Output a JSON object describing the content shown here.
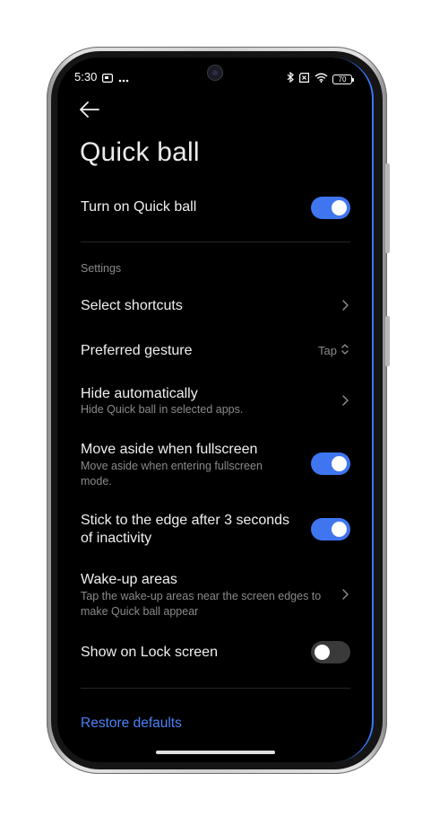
{
  "status_bar": {
    "time": "5:30",
    "left_icons": [
      "gallery-icon",
      "more-icon"
    ],
    "right_icons": [
      "bluetooth-icon",
      "no-sim-icon",
      "wifi-icon",
      "battery-icon"
    ],
    "battery": "70"
  },
  "header": {
    "back_icon": "back-arrow-icon",
    "title": "Quick ball"
  },
  "main_toggle": {
    "label": "Turn on Quick ball",
    "enabled": true
  },
  "settings": {
    "section_label": "Settings",
    "select_shortcuts": {
      "label": "Select shortcuts"
    },
    "preferred_gesture": {
      "label": "Preferred gesture",
      "value": "Tap"
    },
    "hide_automatically": {
      "label": "Hide automatically",
      "description": "Hide Quick ball in selected apps."
    },
    "move_aside": {
      "label": "Move aside when fullscreen",
      "description_line1": "Move aside when entering fullscreen",
      "description_line2": "mode.",
      "enabled": true
    },
    "stick_to_edge": {
      "label_line1": "Stick to the edge after 3 seconds",
      "label_line2": "of inactivity",
      "enabled": true
    },
    "wake_up_areas": {
      "label": "Wake-up areas",
      "description_line1": "Tap the wake-up areas near the screen edges to",
      "description_line2": "make Quick ball appear"
    },
    "lock_screen": {
      "label": "Show on Lock screen",
      "enabled": false
    }
  },
  "footer": {
    "restore_label": "Restore defaults"
  },
  "colors": {
    "accent": "#3f76f0",
    "link": "#4b82f6",
    "background": "#000000",
    "secondary_text": "#8a8a8a"
  }
}
